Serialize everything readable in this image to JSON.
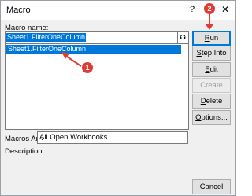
{
  "window": {
    "title": "Macro",
    "help_symbol": "?",
    "close_symbol": "✕"
  },
  "macro_name_label": {
    "mnemonic": "M",
    "rest": "acro name:"
  },
  "macro_name_value": "Sheet1.FilterOneColumn",
  "macro_list": [
    "Sheet1.FilterOneColumn"
  ],
  "upload_icon_glyph": "⮉",
  "buttons": {
    "run": {
      "mnemonic": "R",
      "rest": "un"
    },
    "step_into": {
      "mnemonic": "S",
      "rest": "tep Into"
    },
    "edit": {
      "mnemonic": "E",
      "rest": "dit"
    },
    "create": "Create",
    "delete": {
      "mnemonic": "D",
      "rest": "elete"
    },
    "options": {
      "mnemonic": "O",
      "rest": "ptions..."
    },
    "cancel": "Cancel"
  },
  "macros_in_label": {
    "mnemonic": "A",
    "pre": "Macros ",
    "rest": "n:"
  },
  "macros_in_value": "All Open Workbooks",
  "description_label": "Description",
  "annotations": {
    "badge1": "1",
    "badge2": "2",
    "accent": "#e13b36"
  }
}
